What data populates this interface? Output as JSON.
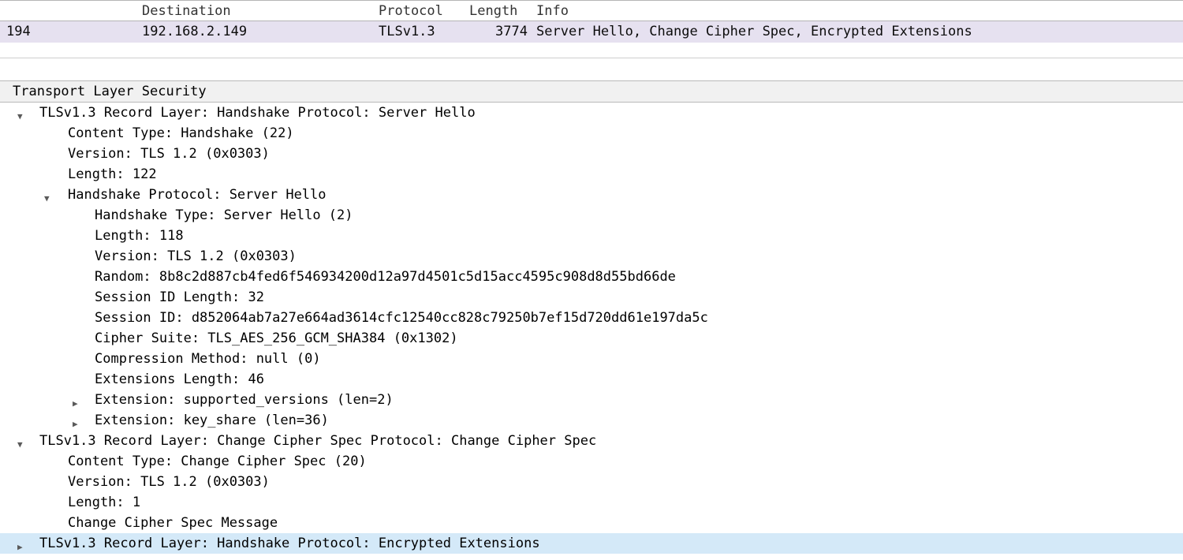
{
  "packet_list": {
    "headers": {
      "destination": "Destination",
      "protocol": "Protocol",
      "length": "Length",
      "info": "Info"
    },
    "row": {
      "no": "194",
      "destination": "192.168.2.149",
      "protocol": "TLSv1.3",
      "length": "3774",
      "info": "Server Hello, Change Cipher Spec, Encrypted Extensions"
    }
  },
  "details": {
    "protocol_title": "Transport Layer Security",
    "record1": {
      "label": "TLSv1.3 Record Layer: Handshake Protocol: Server Hello",
      "content_type": "Content Type: Handshake (22)",
      "version": "Version: TLS 1.2 (0x0303)",
      "length": "Length: 122",
      "handshake": {
        "label": "Handshake Protocol: Server Hello",
        "type": "Handshake Type: Server Hello (2)",
        "length": "Length: 118",
        "version": "Version: TLS 1.2 (0x0303)",
        "random": "Random: 8b8c2d887cb4fed6f546934200d12a97d4501c5d15acc4595c908d8d55bd66de",
        "sid_len": "Session ID Length: 32",
        "sid": "Session ID: d852064ab7a27e664ad3614cfc12540cc828c79250b7ef15d720dd61e197da5c",
        "cipher": "Cipher Suite: TLS_AES_256_GCM_SHA384 (0x1302)",
        "compression": "Compression Method: null (0)",
        "ext_len": "Extensions Length: 46",
        "ext_sv": "Extension: supported_versions (len=2)",
        "ext_ks": "Extension: key_share (len=36)"
      }
    },
    "record2": {
      "label": "TLSv1.3 Record Layer: Change Cipher Spec Protocol: Change Cipher Spec",
      "content_type": "Content Type: Change Cipher Spec (20)",
      "version": "Version: TLS 1.2 (0x0303)",
      "length": "Length: 1",
      "msg": "Change Cipher Spec Message"
    },
    "record3": {
      "label": "TLSv1.3 Record Layer: Handshake Protocol: Encrypted Extensions"
    }
  }
}
